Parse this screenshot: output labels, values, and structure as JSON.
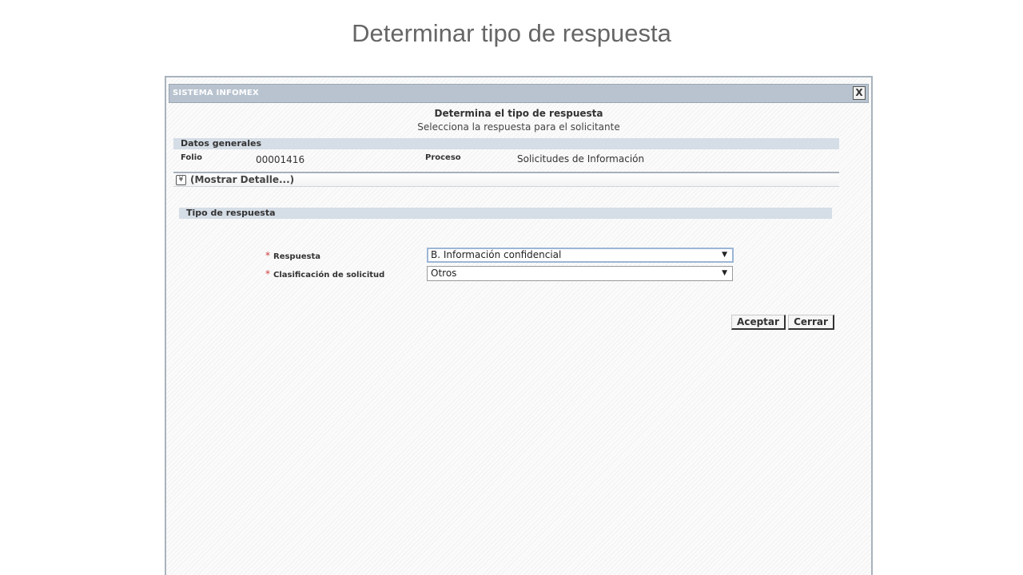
{
  "slide": {
    "title": "Determinar tipo de respuesta"
  },
  "window": {
    "title": "SISTEMA INFOMEX",
    "close_label": "X"
  },
  "form": {
    "heading": "Determina el tipo de respuesta",
    "subheading": "Selecciona la respuesta para el solicitante"
  },
  "general": {
    "section_label": "Datos generales",
    "folio_label": "Folio",
    "folio_value": "00001416",
    "proceso_label": "Proceso",
    "proceso_value": "Solicitudes de Información",
    "detail_icon": "double-chevron-down-icon",
    "detail_link": "(Mostrar Detalle...)"
  },
  "response": {
    "section_label": "Tipo de respuesta",
    "required_marker": "*",
    "respuesta_label": "Respuesta",
    "respuesta_value": "B. Información confidencial",
    "clasificacion_label": "Clasificación de solicitud",
    "clasificacion_value": "Otros",
    "dropdown_arrow": "▼"
  },
  "actions": {
    "accept_label": "Aceptar",
    "close_label": "Cerrar"
  }
}
